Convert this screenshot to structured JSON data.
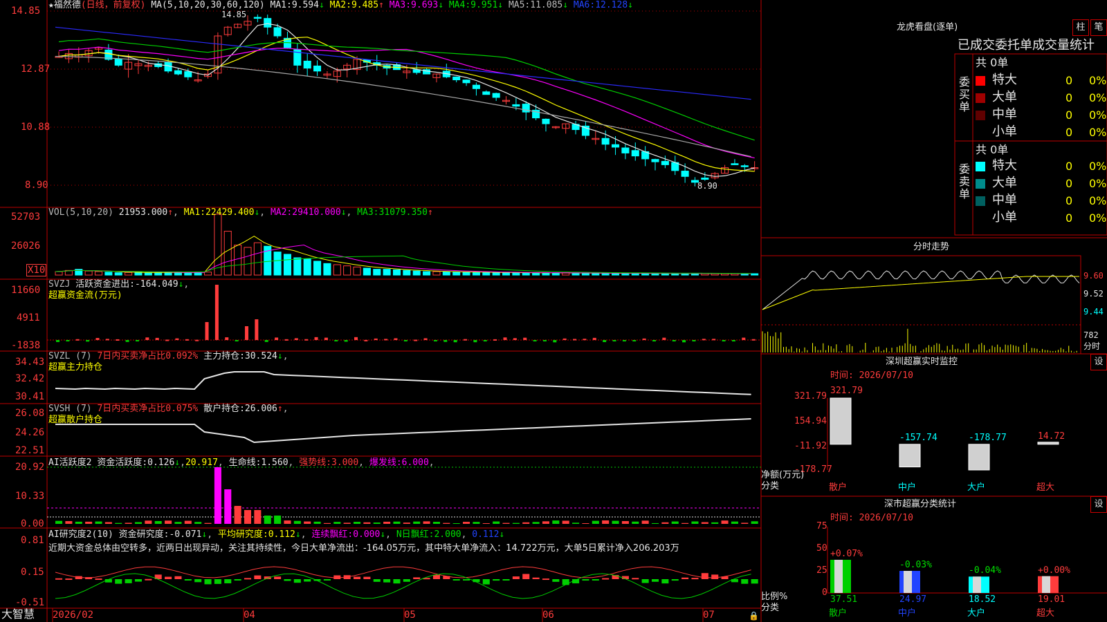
{
  "colors": {
    "up": "#ff3c3c",
    "down": "#00ffff",
    "grid": "#c00000",
    "axis_text": "#ff5050",
    "yellow": "#ffff00",
    "magenta": "#ff00ff",
    "green": "#00d000",
    "blue": "#2b2bff",
    "gray": "#a8a8a8",
    "white": "#e6e6e6",
    "bg": "#000000"
  },
  "main": {
    "stock_name": "★福然德",
    "period": "(日线，前复权)",
    "ma_title": "MA(5,10,20,30,60,120)",
    "ma": [
      {
        "label": "MA1:",
        "value": "9.594",
        "arrow": "↓"
      },
      {
        "label": "MA2:",
        "value": "9.485",
        "arrow": "↑"
      },
      {
        "label": "MA3:",
        "value": "9.693",
        "arrow": "↓"
      },
      {
        "label": "MA4:",
        "value": "9.951",
        "arrow": "↓"
      },
      {
        "label": "MA5:",
        "value": "11.085",
        "arrow": "↓"
      },
      {
        "label": "MA6:",
        "value": "12.128",
        "arrow": "↓"
      }
    ],
    "high_label": "14.85",
    "low_label": "8.90",
    "y_ticks": [
      "14.85",
      "12.87",
      "10.88",
      "8.90"
    ]
  },
  "vol": {
    "title": "VOL(5,10,20)",
    "value": "21953.000",
    "value_arrow": "↑",
    "ma": [
      {
        "label": "MA1:",
        "value": "22429.400",
        "arrow": "↓"
      },
      {
        "label": "MA2:",
        "value": "29410.000",
        "arrow": "↓"
      },
      {
        "label": "MA3:",
        "value": "31079.350",
        "arrow": "↑"
      }
    ],
    "y_ticks": [
      "52703",
      "26026"
    ],
    "unit": "X10"
  },
  "svzj": {
    "title": "SVZJ",
    "label": "活跃资金进出:",
    "value": "-164.049",
    "arrow": "↓",
    "subtitle": "超赢资金流(万元)",
    "y_ticks": [
      "11660",
      "4911",
      "-1838"
    ]
  },
  "svzl": {
    "title": "SVZL (7)",
    "ratio_label": "7日内买卖净占比0.092%",
    "hold_label": "主力持仓:",
    "hold_value": "30.524",
    "arrow": "↓",
    "subtitle": "超赢主力持仓",
    "y_ticks": [
      "34.43",
      "32.42",
      "30.41"
    ]
  },
  "svsh": {
    "title": "SVSH (7)",
    "ratio_label": "7日内买卖净占比0.075%",
    "hold_label": "散户持仓:",
    "hold_value": "26.006",
    "arrow": "↑",
    "subtitle": "超赢散户持仓",
    "y_ticks": [
      "26.08",
      "24.26",
      "22.51"
    ]
  },
  "ai_active": {
    "title": "AI活跃度2",
    "label": "资金活跃度:",
    "value": "0.126",
    "arrow": "↓",
    "v2": "20.917",
    "life_label": "生命线:",
    "life_value": "1.560",
    "strong_label": "强势线:",
    "strong_value": "3.000",
    "burst_label": "爆发线:",
    "burst_value": "6.000",
    "y_ticks": [
      "20.92",
      "10.33",
      "0.00"
    ]
  },
  "ai_research": {
    "title": "AI研究度2(10)",
    "label": "资金研究度:",
    "value": "-0.071",
    "arrow": "↓",
    "avg_label": "平均研究度:",
    "avg_value": "0.112",
    "avg_arrow": "↓",
    "red_label": "连续飘红:",
    "red_value": "0.000",
    "red_arrow": "↓",
    "n_label": "N日飘红:",
    "n_value": "2.000",
    "n_value2": "0.112",
    "n_arrow": "↓",
    "comment": "近期大资金总体由空转多，近两日出现异动，关注其持续性，今日大单净流出：-164.05万元，其中特大单净流入：14.722万元，大单5日累计净入206.203万",
    "y_ticks": [
      "0.81",
      "0.15",
      "-0.51"
    ]
  },
  "x_axis": {
    "labels": [
      "2026/02",
      "04",
      "05",
      "06",
      "07"
    ]
  },
  "brand": "大智慧",
  "lhb": {
    "title": "龙虎看盘(逐单)",
    "btn_bar": "柱",
    "btn_pen": "笔",
    "subtitle": "已成交委托单成交量统计",
    "buy_side": "委买单",
    "sell_side": "委卖单",
    "buy_total": "共 0单",
    "sell_total": "共 0单",
    "buy_rows": [
      {
        "label": "特大",
        "count": "0",
        "pct": "0%",
        "color": "#ff0000"
      },
      {
        "label": "大单",
        "count": "0",
        "pct": "0%",
        "color": "#a00000"
      },
      {
        "label": "中单",
        "count": "0",
        "pct": "0%",
        "color": "#600000"
      },
      {
        "label": "小单",
        "count": "0",
        "pct": "0%",
        "color": "#000000"
      }
    ],
    "sell_rows": [
      {
        "label": "特大",
        "count": "0",
        "pct": "0%",
        "color": "#00ffff"
      },
      {
        "label": "大单",
        "count": "0",
        "pct": "0%",
        "color": "#008b8b"
      },
      {
        "label": "中单",
        "count": "0",
        "pct": "0%",
        "color": "#006060"
      },
      {
        "label": "小单",
        "count": "0",
        "pct": "0%",
        "color": "#000000"
      }
    ]
  },
  "intraday": {
    "title": "分时走势",
    "y_ticks": [
      "9.60",
      "9.52",
      "9.44"
    ],
    "vol_tick": "782",
    "vol_unit": "分时"
  },
  "sz_monitor": {
    "title": "深圳超赢实时监控",
    "setting": "设",
    "time_label": "时间: 2026/07/10",
    "y_ticks": [
      "321.79",
      "154.94",
      "-11.92",
      "-178.77"
    ],
    "ylabel1": "净额(万元)",
    "ylabel2": "分类",
    "bars": [
      {
        "cat": "散户",
        "value": "321.79"
      },
      {
        "cat": "中户",
        "value": "-157.74"
      },
      {
        "cat": "大户",
        "value": "-178.77"
      },
      {
        "cat": "超大",
        "value": "14.72"
      }
    ]
  },
  "sz_stats": {
    "title": "深市超赢分类统计",
    "setting": "设",
    "time_label": "时间: 2026/07/10",
    "y_ticks": [
      "75",
      "50",
      "25",
      "0"
    ],
    "ylabel1": "比例%",
    "ylabel2": "分类",
    "bars": [
      {
        "cat": "散户",
        "value": "37.51",
        "change": "+0.07%"
      },
      {
        "cat": "中户",
        "value": "24.97",
        "change": "-0.03%"
      },
      {
        "cat": "大户",
        "value": "18.52",
        "change": "-0.04%"
      },
      {
        "cat": "超大",
        "value": "19.01",
        "change": "+0.00%"
      }
    ]
  },
  "chart_data": [
    {
      "type": "candlestick",
      "title": "福然德 日线",
      "ma_lines": [
        "MA5",
        "MA10",
        "MA20",
        "MA30",
        "MA60",
        "MA120"
      ],
      "ylim": [
        8.9,
        14.85
      ],
      "high": {
        "value": 14.85
      },
      "low": {
        "value": 8.9
      },
      "series_close": [
        13.3,
        13.4,
        13.35,
        13.5,
        13.6,
        13.2,
        13.0,
        13.1,
        13.05,
        13.0,
        12.95,
        12.8,
        12.7,
        12.6,
        12.5,
        12.7,
        14.0,
        14.3,
        14.4,
        14.5,
        14.6,
        14.3,
        14.0,
        13.6,
        13.0,
        12.9,
        12.8,
        12.7,
        12.8,
        13.0,
        13.2,
        13.1,
        13.0,
        12.9,
        12.85,
        12.8,
        12.75,
        12.7,
        12.7,
        12.6,
        12.5,
        12.4,
        12.2,
        12.0,
        11.9,
        11.8,
        11.6,
        11.4,
        11.2,
        11.0,
        10.9,
        11.0,
        10.8,
        10.6,
        10.5,
        10.3,
        10.2,
        10.0,
        9.9,
        9.8,
        9.7,
        9.6,
        9.4,
        9.2,
        9.0,
        9.1,
        9.3,
        9.5,
        9.6,
        9.55,
        9.5
      ]
    },
    {
      "type": "bar",
      "title": "VOL(5,10,20)",
      "ylim": [
        0,
        52703
      ],
      "values": [
        3000,
        4000,
        5000,
        3500,
        3000,
        2500,
        2000,
        2200,
        2500,
        2000,
        2100,
        2300,
        2400,
        2000,
        2500,
        2600,
        52703,
        38000,
        26000,
        24000,
        28000,
        25000,
        20000,
        18000,
        15000,
        14000,
        12000,
        10000,
        9000,
        8000,
        7000,
        6000,
        5000,
        5000,
        4500,
        4000,
        3500,
        3000,
        3000,
        2800,
        2600,
        2500,
        2400,
        2300,
        2200,
        2100,
        2000,
        2000,
        2000,
        1900,
        1800,
        1800,
        1700,
        1700,
        1600,
        1600,
        1500,
        1500,
        1500,
        1400,
        1400,
        1400,
        1300,
        1300,
        1300,
        1300,
        1200,
        1200,
        1200,
        1200,
        1200
      ]
    },
    {
      "type": "bar",
      "title": "超赢资金流(万元)",
      "ylim": [
        -1838,
        11660
      ],
      "spike": {
        "value": 11660
      }
    },
    {
      "type": "line",
      "title": "超赢主力持仓",
      "ylim": [
        30.41,
        34.43
      ]
    },
    {
      "type": "line",
      "title": "超赢散户持仓",
      "ylim": [
        22.51,
        26.08
      ]
    },
    {
      "type": "bar",
      "title": "AI活跃度2",
      "ylim": [
        0,
        20.92
      ]
    },
    {
      "type": "bar",
      "title": "AI研究度2(10)",
      "ylim": [
        -0.51,
        0.81
      ]
    },
    {
      "type": "bar",
      "title": "深圳超赢实时监控",
      "categories": [
        "散户",
        "中户",
        "大户",
        "超大"
      ],
      "values": [
        321.79,
        -157.74,
        -178.77,
        14.72
      ],
      "ylim": [
        -178.77,
        321.79
      ]
    },
    {
      "type": "bar",
      "title": "深市超赢分类统计",
      "categories": [
        "散户",
        "中户",
        "大户",
        "超大"
      ],
      "values": [
        37.51,
        24.97,
        18.52,
        19.01
      ],
      "ylim": [
        0,
        75
      ]
    }
  ]
}
